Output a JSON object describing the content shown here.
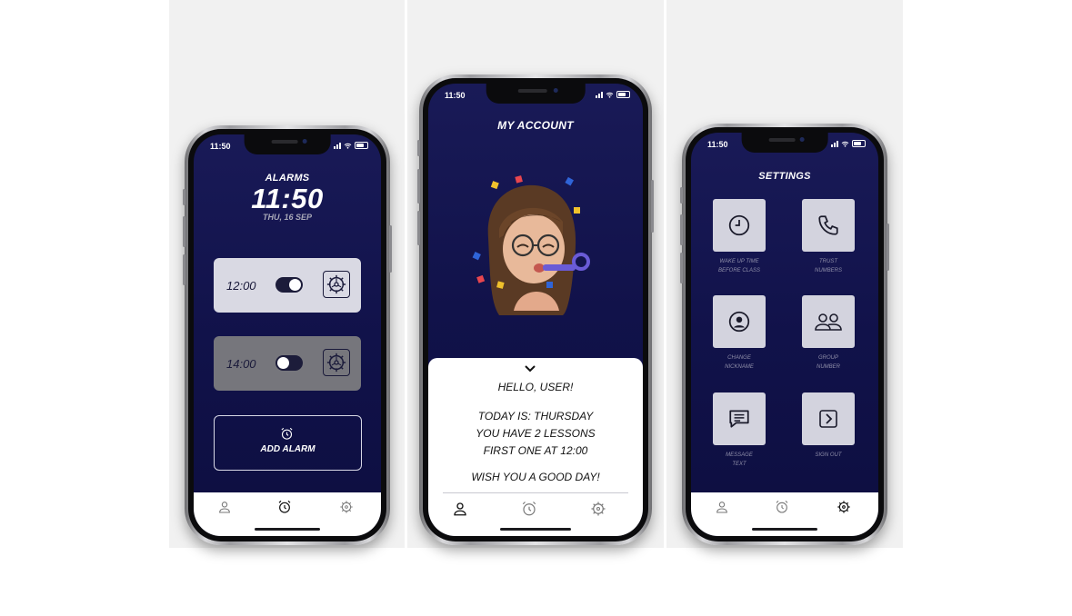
{
  "colors": {
    "screen_bg": "#13144d",
    "card_light": "#d9d9e3",
    "card_dim": "#76767c",
    "toggle_on": "#1c1c3a",
    "toggle_off": "#1c1c3a"
  },
  "alarms_screen": {
    "status_time": "11:50",
    "title": "ALARMS",
    "clock_time": "11:50",
    "clock_date": "THU, 16 SEP",
    "alarms": [
      {
        "time": "12:00",
        "enabled": true
      },
      {
        "time": "14:00",
        "enabled": false
      }
    ],
    "add_label": "ADD ALARM",
    "nav": [
      "user-icon",
      "alarm-clock-icon",
      "gear-icon"
    ]
  },
  "account_screen": {
    "status_time": "11:50",
    "title": "MY ACCOUNT",
    "greeting": "HELLO, USER!",
    "line1": "TODAY IS: THURSDAY",
    "line2": "YOU HAVE 2 LESSONS",
    "line3": "FIRST ONE AT 12:00",
    "wish": "WISH YOU A GOOD DAY!",
    "nav": [
      "user-icon",
      "alarm-clock-icon",
      "gear-icon"
    ]
  },
  "settings_screen": {
    "status_time": "11:50",
    "title": "SETTINGS",
    "tiles": [
      {
        "icon": "clock-icon",
        "line1": "WAKE UP TIME",
        "line2": "BEFORE CLASS"
      },
      {
        "icon": "phone-icon",
        "line1": "TRUST",
        "line2": "NUMBERS"
      },
      {
        "icon": "user-circle-icon",
        "line1": "CHANGE",
        "line2": "NICKNAME"
      },
      {
        "icon": "group-icon",
        "line1": "GROUP",
        "line2": "NUMBER"
      },
      {
        "icon": "message-icon",
        "line1": "MESSAGE",
        "line2": "TEXT"
      },
      {
        "icon": "sign-out-icon",
        "line1": "SIGN OUT",
        "line2": ""
      }
    ],
    "nav": [
      "user-icon",
      "alarm-clock-icon",
      "gear-icon"
    ]
  }
}
